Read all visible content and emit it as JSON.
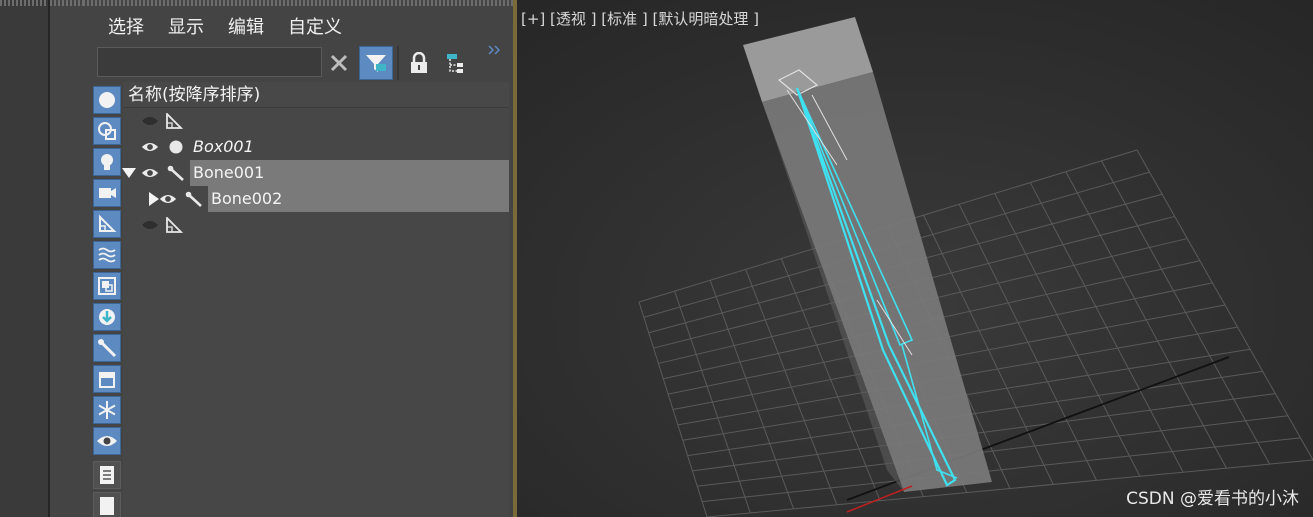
{
  "menu": [
    "选择",
    "显示",
    "编辑",
    "自定义"
  ],
  "search": {
    "value": "",
    "placeholder": ""
  },
  "toolbar_icons": [
    "clear-x-icon",
    "filter-funnel-icon",
    "lock-icon",
    "hierarchy-icon",
    "expand-chevron-icon"
  ],
  "filter_icons": [
    "sphere-icon",
    "shapes-icon",
    "light-bulb-icon",
    "camera-icon",
    "helper-icon",
    "spacewarp-icon",
    "group-icon",
    "xref-icon",
    "bone-icon",
    "container-icon",
    "freeze-icon",
    "visibility-eye-icon",
    "document-icon",
    "blank-icon"
  ],
  "tree": {
    "header": "名称(按降序排序)",
    "rows": [
      {
        "name": "",
        "type": "helper"
      },
      {
        "name": "Box001",
        "type": "geometry"
      },
      {
        "name": "Bone001",
        "type": "bone"
      },
      {
        "name": "Bone002",
        "type": "bone"
      },
      {
        "name": "",
        "type": "helper"
      }
    ]
  },
  "viewport": {
    "label": "[+] [透视 ] [标准 ] [默认明暗处理 ]"
  },
  "watermark": "CSDN @爱看书的小沐",
  "colors": {
    "accent": "#5c8ac1",
    "selection": "#7a7a7a",
    "bone_wire": "#3fe0f0"
  }
}
